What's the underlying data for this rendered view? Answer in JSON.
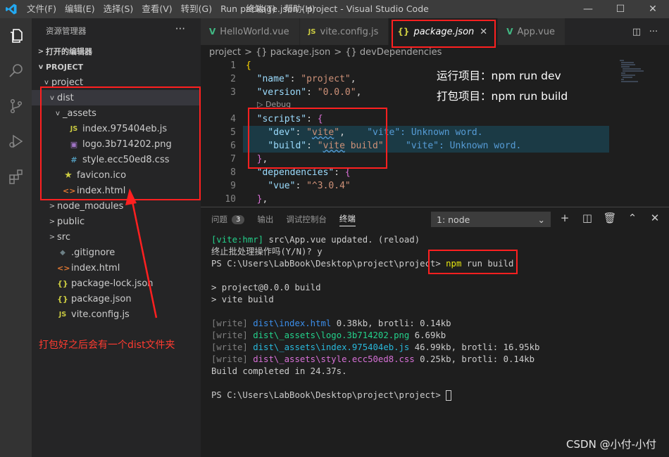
{
  "titlebar": {
    "menu": [
      "文件(F)",
      "编辑(E)",
      "选择(S)",
      "查看(V)",
      "转到(G)",
      "Run",
      "终端(T)",
      "帮助(H)"
    ],
    "title": "package.json - project - Visual Studio Code",
    "minimize": "—",
    "maximize": "☐",
    "close": "✕"
  },
  "sidebar": {
    "header": "资源管理器",
    "dots": "···",
    "open_editors": "打开的编辑器",
    "project_section": "PROJECT",
    "tree": [
      {
        "label": "project",
        "icon": "",
        "indent": 1,
        "chev": "v"
      },
      {
        "label": "dist",
        "icon": "",
        "indent": 2,
        "chev": "v"
      },
      {
        "label": "_assets",
        "icon": "",
        "indent": 3,
        "chev": "v"
      },
      {
        "label": "index.975404eb.js",
        "icon": "JS",
        "indent": 4,
        "chev": ""
      },
      {
        "label": "logo.3b714202.png",
        "icon": "▣",
        "indent": 4,
        "chev": ""
      },
      {
        "label": "style.ecc50ed8.css",
        "icon": "#",
        "indent": 4,
        "chev": ""
      },
      {
        "label": "favicon.ico",
        "icon": "★",
        "indent": 3,
        "chev": ""
      },
      {
        "label": "index.html",
        "icon": "<>",
        "indent": 3,
        "chev": ""
      },
      {
        "label": "node_modules",
        "icon": "",
        "indent": 2,
        "chev": ">"
      },
      {
        "label": "public",
        "icon": "",
        "indent": 2,
        "chev": ">"
      },
      {
        "label": "src",
        "icon": "",
        "indent": 2,
        "chev": ">"
      },
      {
        "label": ".gitignore",
        "icon": "◆",
        "indent": 2,
        "chev": ""
      },
      {
        "label": "index.html",
        "icon": "<>",
        "indent": 2,
        "chev": ""
      },
      {
        "label": "package-lock.json",
        "icon": "{}",
        "indent": 2,
        "chev": ""
      },
      {
        "label": "package.json",
        "icon": "{}",
        "indent": 2,
        "chev": ""
      },
      {
        "label": "vite.config.js",
        "icon": "JS",
        "indent": 2,
        "chev": ""
      }
    ],
    "annotation": "打包好之后会有一个dist文件夹"
  },
  "tabs": [
    {
      "label": "HelloWorld.vue",
      "icon": "V",
      "active": false
    },
    {
      "label": "vite.config.js",
      "icon": "JS",
      "active": false
    },
    {
      "label": "package.json",
      "icon": "{}",
      "active": true
    },
    {
      "label": "App.vue",
      "icon": "V",
      "active": false
    }
  ],
  "tab_close": "✕",
  "breadcrumb": [
    "project",
    ">",
    "{} package.json",
    ">",
    "{} devDependencies"
  ],
  "editor": {
    "line_numbers": [
      "1",
      "2",
      "3",
      "",
      "4",
      "5",
      "6",
      "7",
      "8",
      "9",
      "10"
    ],
    "codelens": "▷ Debug",
    "annotation_run": "运行项目：npm run dev",
    "annotation_build": "打包项目：npm run build",
    "unknown_dev": "\"vite\": Unknown word.",
    "unknown_build": "\"vite\": Unknown word."
  },
  "panel": {
    "tabs": [
      {
        "label": "问题",
        "badge": "3"
      },
      {
        "label": "输出",
        "badge": ""
      },
      {
        "label": "调试控制台",
        "badge": ""
      },
      {
        "label": "终端",
        "badge": ""
      }
    ],
    "terminal_select": "1: node",
    "terminal_lines": {
      "l1_tag": "[vite:hmr]",
      "l1_rest": " src\\App.vue updated. (reload)",
      "l2": "终止批处理操作吗(Y/N)? y",
      "l3_prompt": "PS C:\\Users\\LabBook\\Desktop\\project\\project>",
      "l3_cmd": "npm",
      "l3_args": " run build",
      "l4": "> project@0.0.0 build",
      "l5": "> vite build",
      "w1_tag": "[write]",
      "w1_file": "dist\\index.html",
      "w1_size": " 0.38kb, brotli: 0.14kb",
      "w2_tag": "[write]",
      "w2_file": "dist\\_assets\\logo.3b714202.png",
      "w2_size": " 6.69kb",
      "w3_tag": "[write]",
      "w3_file": "dist\\_assets\\index.975404eb.js",
      "w3_size": " 46.99kb, brotli: 16.95kb",
      "w4_tag": "[write]",
      "w4_file": "dist\\_assets\\style.ecc50ed8.css",
      "w4_size": " 0.25kb, brotli: 0.14kb",
      "done": "Build completed in 24.37s.",
      "final_prompt": "PS C:\\Users\\LabBook\\Desktop\\project\\project>"
    }
  },
  "watermark": "CSDN @小付-小付"
}
